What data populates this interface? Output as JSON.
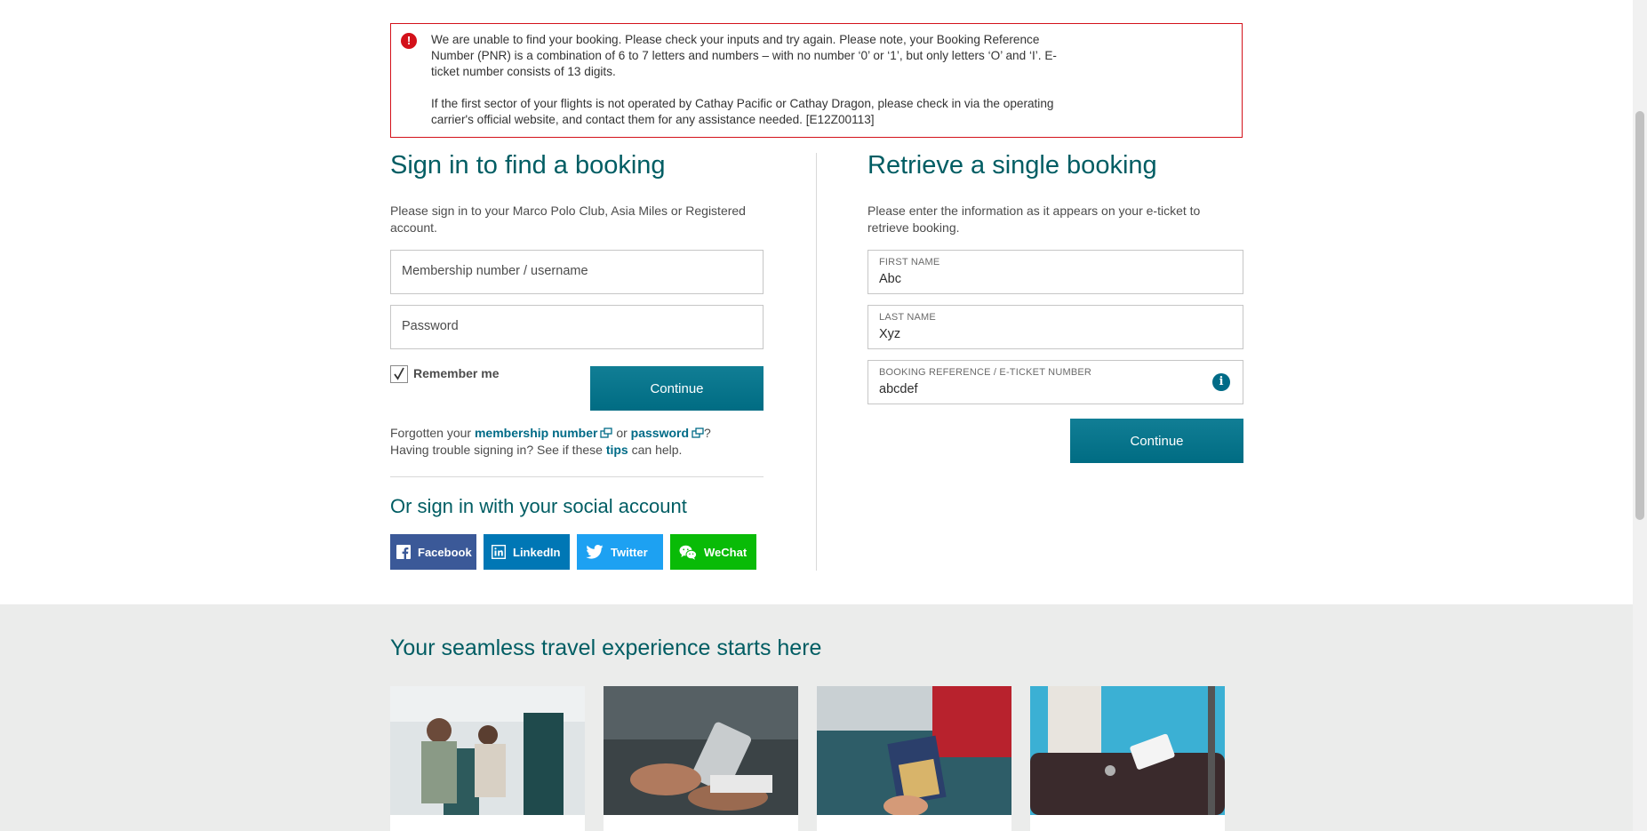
{
  "error": {
    "line1": "We are unable to find your booking. Please check your inputs and try again. Please note, your Booking Reference Number (PNR) is a combination of 6 to 7 letters and numbers – with no number ‘0’ or ‘1’, but only letters ‘O’ and ‘I’. E-ticket number consists of 13 digits.",
    "line2": "If the first sector of your flights is not operated by Cathay Pacific or Cathay Dragon, please check in via the operating carrier's official website, and contact them for any assistance needed. [E12Z00113]"
  },
  "signin": {
    "title": "Sign in to find a booking",
    "desc": "Please sign in to your Marco Polo Club, Asia Miles or Registered account.",
    "username_placeholder": "Membership number / username",
    "password_placeholder": "Password",
    "remember_label": "Remember me",
    "remember_checked": true,
    "continue_label": "Continue",
    "forgot_prefix": "Forgotten your",
    "membership_link": "membership number",
    "or": "or",
    "password_link": "password",
    "question_mark": "?",
    "trouble_prefix": "Having trouble signing in? See if these",
    "tips_link": "tips",
    "trouble_suffix": "can help."
  },
  "social": {
    "title": "Or sign in with your social account",
    "buttons": [
      {
        "label": "Facebook",
        "color": "#3b5998"
      },
      {
        "label": "LinkedIn",
        "color": "#0077b5"
      },
      {
        "label": "Twitter",
        "color": "#1da1f2"
      },
      {
        "label": "WeChat",
        "color": "#09bb07"
      }
    ]
  },
  "retrieve": {
    "title": "Retrieve a single booking",
    "desc": "Please enter the information as it appears on your e-ticket to retrieve booking.",
    "first_name_label": "FIRST NAME",
    "first_name_value": "Abc",
    "last_name_label": "LAST NAME",
    "last_name_value": "Xyz",
    "booking_ref_label": "BOOKING REFERENCE / E-TICKET NUMBER",
    "booking_ref_value": "abcdef",
    "continue_label": "Continue"
  },
  "experience": {
    "title": "Your seamless travel experience starts here"
  },
  "colors": {
    "brand_teal": "#005d63",
    "button_teal": "#006c83",
    "error_red": "#d3111a"
  }
}
